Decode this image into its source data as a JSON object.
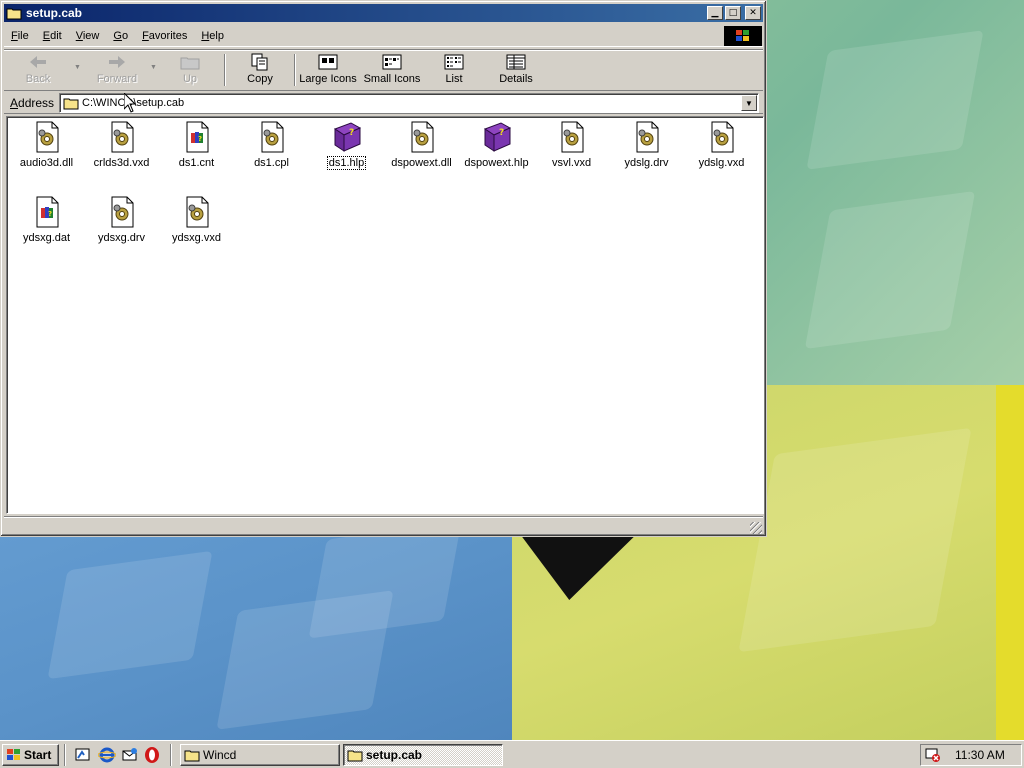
{
  "window": {
    "title": "setup.cab",
    "controls": {
      "minimize": "▁",
      "maximize": "□",
      "close": "✕"
    }
  },
  "menu": [
    "File",
    "Edit",
    "View",
    "Go",
    "Favorites",
    "Help"
  ],
  "toolbar": {
    "back": "Back",
    "forward": "Forward",
    "up": "Up",
    "copy": "Copy",
    "large_icons": "Large Icons",
    "small_icons": "Small Icons",
    "list": "List",
    "details": "Details"
  },
  "address": {
    "label": "Address",
    "value": "C:\\WINCD\\setup.cab"
  },
  "files": [
    {
      "name": "audio3d.dll",
      "icon": "gear-file-icon"
    },
    {
      "name": "crlds3d.vxd",
      "icon": "gear-file-icon"
    },
    {
      "name": "ds1.cnt",
      "icon": "help-contents-file-icon"
    },
    {
      "name": "ds1.cpl",
      "icon": "gear-file-icon"
    },
    {
      "name": "ds1.hlp",
      "icon": "help-book-icon",
      "focused": true
    },
    {
      "name": "dspowext.dll",
      "icon": "gear-file-icon"
    },
    {
      "name": "dspowext.hlp",
      "icon": "help-book-icon"
    },
    {
      "name": "vsvl.vxd",
      "icon": "gear-file-icon"
    },
    {
      "name": "ydslg.drv",
      "icon": "gear-file-icon"
    },
    {
      "name": "ydslg.vxd",
      "icon": "gear-file-icon"
    },
    {
      "name": "ydsxg.dat",
      "icon": "help-contents-file-icon"
    },
    {
      "name": "ydsxg.drv",
      "icon": "gear-file-icon"
    },
    {
      "name": "ydsxg.vxd",
      "icon": "gear-file-icon"
    }
  ],
  "taskbar": {
    "start": "Start",
    "tasks": [
      {
        "label": "Wincd",
        "active": false
      },
      {
        "label": "setup.cab",
        "active": true
      }
    ],
    "clock": "11:30 AM"
  }
}
